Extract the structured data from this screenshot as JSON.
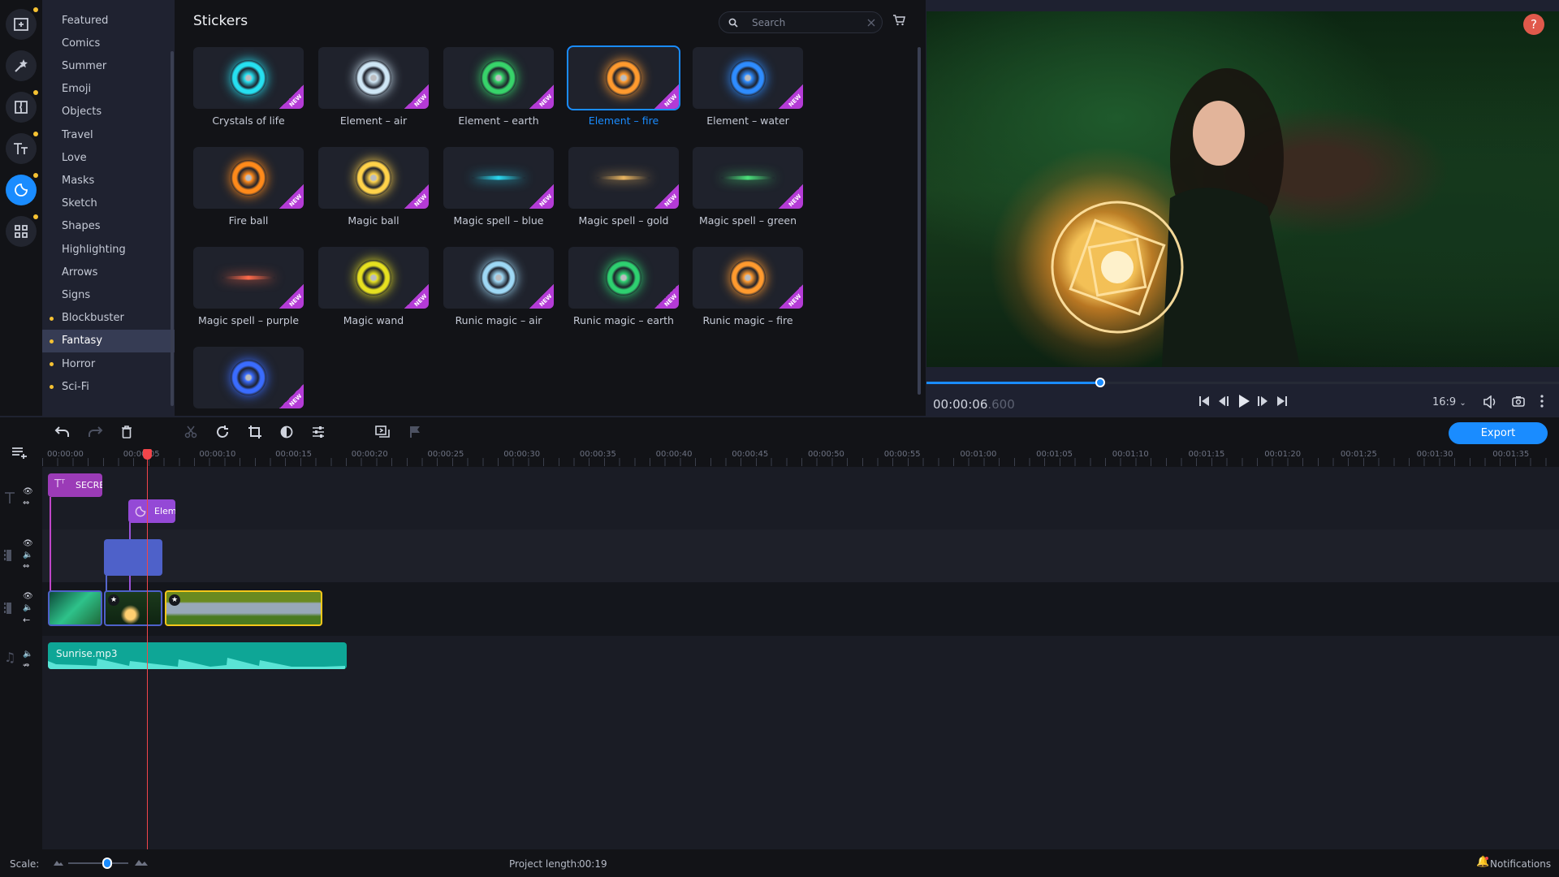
{
  "rail": {
    "items": [
      {
        "name": "import",
        "icon": "import-folder-icon",
        "dot": true,
        "active": false
      },
      {
        "name": "filters",
        "icon": "magic-wand-icon",
        "dot": false,
        "active": false
      },
      {
        "name": "transitions",
        "icon": "transitions-icon",
        "dot": true,
        "active": false
      },
      {
        "name": "titles",
        "icon": "titles-icon",
        "dot": true,
        "active": false
      },
      {
        "name": "stickers",
        "icon": "sticker-icon",
        "dot": true,
        "active": true
      },
      {
        "name": "more-tools",
        "icon": "grid-icon",
        "dot": true,
        "active": false
      }
    ]
  },
  "categories": [
    {
      "label": "Featured",
      "dot": false
    },
    {
      "label": "Comics",
      "dot": false
    },
    {
      "label": "Summer",
      "dot": false
    },
    {
      "label": "Emoji",
      "dot": false
    },
    {
      "label": "Objects",
      "dot": false
    },
    {
      "label": "Travel",
      "dot": false
    },
    {
      "label": "Love",
      "dot": false
    },
    {
      "label": "Masks",
      "dot": false
    },
    {
      "label": "Sketch",
      "dot": false
    },
    {
      "label": "Shapes",
      "dot": false
    },
    {
      "label": "Highlighting",
      "dot": false
    },
    {
      "label": "Arrows",
      "dot": false
    },
    {
      "label": "Signs",
      "dot": false
    },
    {
      "label": "Blockbuster",
      "dot": true
    },
    {
      "label": "Fantasy",
      "dot": true,
      "active": true
    },
    {
      "label": "Horror",
      "dot": true
    },
    {
      "label": "Sci-Fi",
      "dot": true
    }
  ],
  "stickers": {
    "title": "Stickers",
    "search_placeholder": "Search",
    "new_badge": "NEW",
    "items": [
      {
        "label": "Crystals of life",
        "color": "#26e0f0"
      },
      {
        "label": "Element – air",
        "color": "#cfe6f5"
      },
      {
        "label": "Element – earth",
        "color": "#37d46a"
      },
      {
        "label": "Element – fire",
        "color": "#ff9a2e",
        "selected": true
      },
      {
        "label": "Element – water",
        "color": "#2e8cff"
      },
      {
        "label": "Fire ball",
        "color": "#ff8a1a"
      },
      {
        "label": "Magic ball",
        "color": "#ffd24a"
      },
      {
        "label": "Magic spell – blue",
        "color": "#2ad8f0"
      },
      {
        "label": "Magic spell – gold",
        "color": "#e8b460"
      },
      {
        "label": "Magic spell – green",
        "color": "#4be07a"
      },
      {
        "label": "Magic spell – purple",
        "color": "#ff6a4a"
      },
      {
        "label": "Magic wand",
        "color": "#e6e020"
      },
      {
        "label": "Runic magic – air",
        "color": "#9ed8f5"
      },
      {
        "label": "Runic magic – earth",
        "color": "#2ed070"
      },
      {
        "label": "Runic magic – fire",
        "color": "#ff9a2e"
      },
      {
        "label": "",
        "color": "#3a6cff"
      }
    ]
  },
  "preview": {
    "timecode_main": "00:00:06",
    "timecode_ms": ".600",
    "progress": 0.275,
    "aspect_ratio": "16:9",
    "help": "?"
  },
  "toolbar": {
    "export_label": "Export"
  },
  "ruler": {
    "labels": [
      "00:00:00",
      "00:00:05",
      "00:00:10",
      "00:00:15",
      "00:00:20",
      "00:00:25",
      "00:00:30",
      "00:00:35",
      "00:00:40",
      "00:00:45",
      "00:00:50",
      "00:00:55",
      "00:01:00",
      "00:01:05",
      "00:01:10",
      "00:01:15",
      "00:01:20",
      "00:01:25",
      "00:01:30",
      "00:01:35"
    ]
  },
  "timeline": {
    "title_clip": "SECRET",
    "sticker_clip": "Element – fire",
    "audio_clip": "Sunrise.mp3"
  },
  "bottom": {
    "scale_label": "Scale:",
    "scale_value": 0.65,
    "project_length_label": "Project length:",
    "project_length": "00:19",
    "notifications": "Notifications"
  }
}
